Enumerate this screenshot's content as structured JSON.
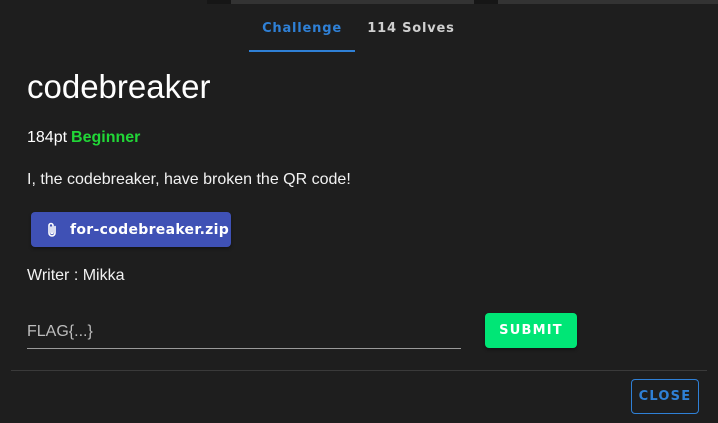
{
  "tabs": [
    {
      "label": "Challenge",
      "active": true
    },
    {
      "label": "114 Solves",
      "active": false
    }
  ],
  "challenge": {
    "title": "codebreaker",
    "points": "184pt",
    "difficulty": "Beginner",
    "description": "I, the codebreaker, have broken the QR code!",
    "attachment": {
      "label": "for-codebreaker.zip",
      "icon": "paperclip-icon"
    },
    "writer": "Writer : Mikka"
  },
  "flag_input": {
    "value": "",
    "placeholder": "FLAG{...}"
  },
  "buttons": {
    "submit": "SUBMIT",
    "close": "CLOSE"
  },
  "colors": {
    "background": "#1e1e1e",
    "accent": "#2f80d6",
    "difficulty": "#21d637",
    "attachment_button": "#3f51b5",
    "submit_button": "#00e676"
  }
}
